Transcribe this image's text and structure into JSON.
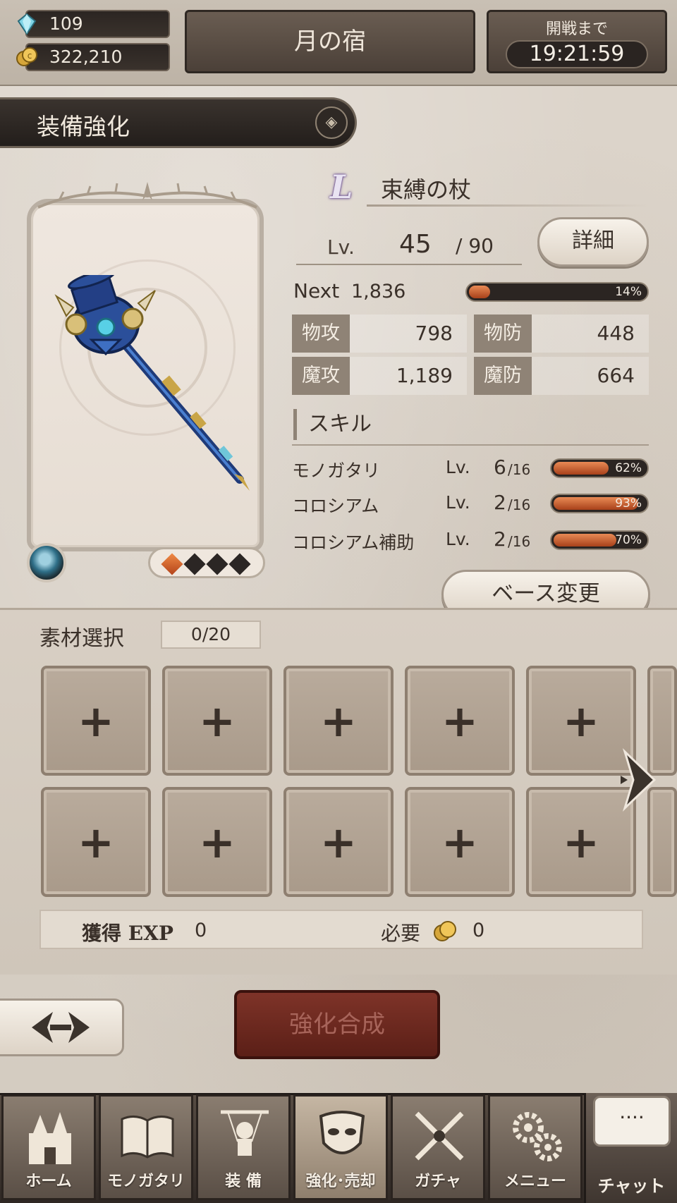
{
  "header": {
    "gems": "109",
    "coins": "322,210",
    "location_title": "月の宿",
    "timer_label": "開戦まで",
    "timer_value": "19:21:59"
  },
  "section": {
    "title": "装備強化"
  },
  "item": {
    "rarity": "L",
    "name": "束縛の杖",
    "level_label": "Lv.",
    "level": "45",
    "level_max": "/ 90",
    "detail_button": "詳細",
    "next_label": "Next",
    "next_value": "1,836",
    "exp_progress_text": "14%",
    "exp_progress": 0.14,
    "element_icon": "water-drop-icon",
    "rarity_diamonds_lit": 1,
    "rarity_diamonds_total": 4,
    "stats": [
      {
        "label": "物攻",
        "value": "798"
      },
      {
        "label": "物防",
        "value": "448"
      },
      {
        "label": "魔攻",
        "value": "1,189"
      },
      {
        "label": "魔防",
        "value": "664"
      }
    ],
    "skill_header": "スキル",
    "skills": [
      {
        "name": "モノガタリ",
        "lv_label": "Lv.",
        "lv": "6",
        "lv_max": "/16",
        "progress_text": "62%",
        "progress": 0.62
      },
      {
        "name": "コロシアム",
        "lv_label": "Lv.",
        "lv": "2",
        "lv_max": "/16",
        "progress_text": "93%",
        "progress": 0.93
      },
      {
        "name": "コロシアム補助",
        "lv_label": "Lv.",
        "lv": "2",
        "lv_max": "/16",
        "progress_text": "70%",
        "progress": 0.7
      }
    ],
    "base_change_button": "ベース変更"
  },
  "materials": {
    "title": "素材選択",
    "count": "0/20",
    "slot_symbol": "+",
    "gained_exp_label": "獲得 EXP",
    "gained_exp_value": "0",
    "required_label": "必要",
    "required_value": "0"
  },
  "actions": {
    "synthesize_button": "強化合成"
  },
  "nav": {
    "items": [
      {
        "label": "ホーム",
        "icon": "castle-icon"
      },
      {
        "label": "モノガタリ",
        "icon": "book-icon"
      },
      {
        "label": "装 備",
        "icon": "puppet-icon"
      },
      {
        "label": "強化･売却",
        "icon": "mask-icon"
      },
      {
        "label": "ガチャ",
        "icon": "crossed-swords-icon"
      },
      {
        "label": "メニュー",
        "icon": "gears-icon"
      }
    ],
    "active_index": 3,
    "chat_label": "チャット",
    "chat_bubble": "····"
  },
  "colors": {
    "accent_dark": "#2b2522",
    "bar_fill": "#c45a2b",
    "synth_button": "#6b271d"
  }
}
